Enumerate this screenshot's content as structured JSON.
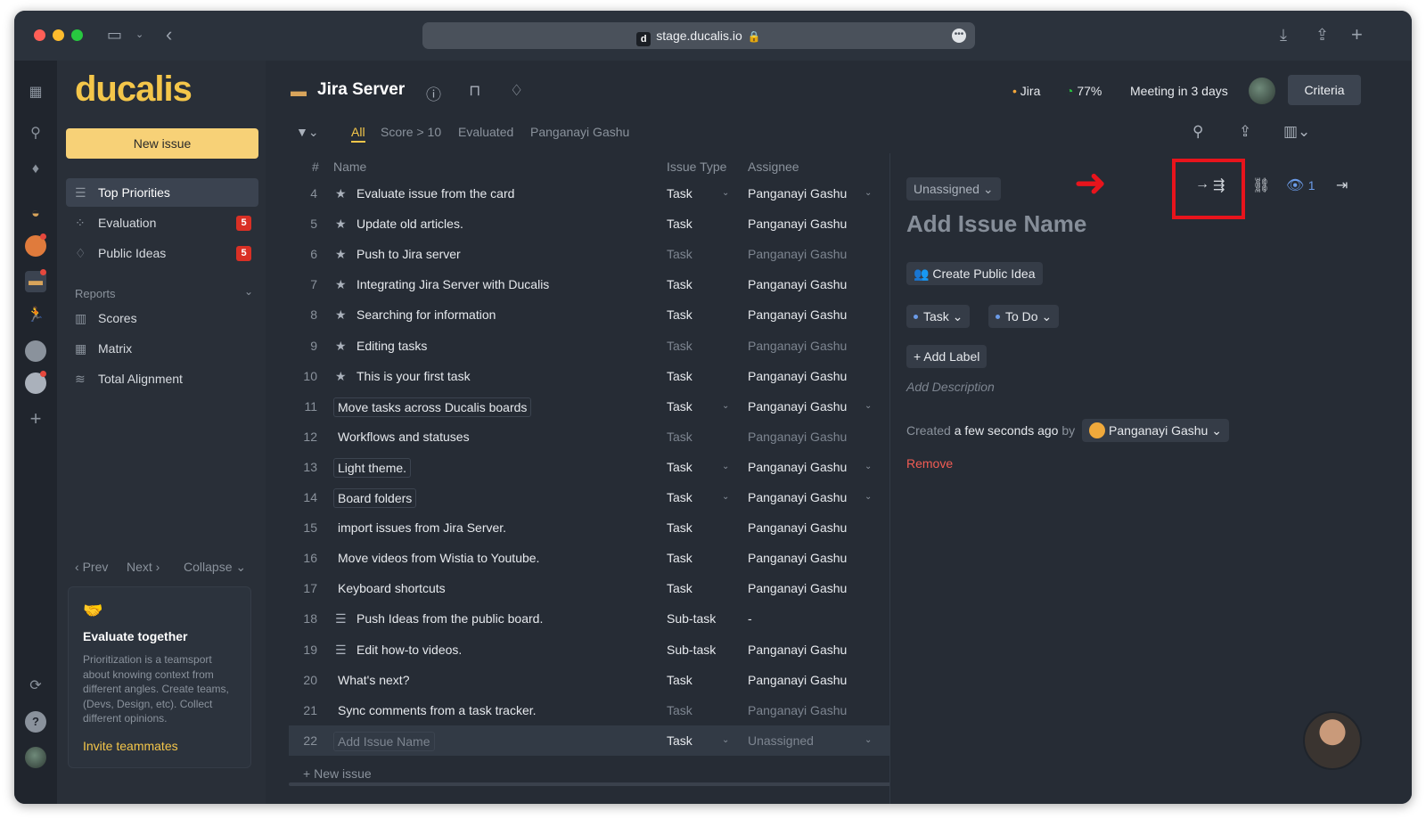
{
  "browser": {
    "url": "stage.ducalis.io",
    "favicon_letter": "d"
  },
  "sidebar": {
    "logo": "ducalis",
    "new_issue": "New issue",
    "nav": [
      {
        "label": "Top Priorities",
        "icon": "list-icon",
        "active": true
      },
      {
        "label": "Evaluation",
        "icon": "nodes-icon",
        "badge": "5"
      },
      {
        "label": "Public Ideas",
        "icon": "lightbulb-icon",
        "badge": "5"
      }
    ],
    "reports_label": "Reports",
    "reports": [
      {
        "label": "Scores",
        "icon": "columns-icon"
      },
      {
        "label": "Matrix",
        "icon": "grid-icon"
      },
      {
        "label": "Total Alignment",
        "icon": "layers-icon"
      }
    ],
    "pager": {
      "prev": "Prev",
      "next": "Next",
      "collapse": "Collapse"
    },
    "promo": {
      "title": "Evaluate together",
      "text": "Prioritization is a teamsport about knowing context from different angles. Create teams, (Devs, Design, etc). Collect different opinions.",
      "link": "Invite teammates"
    }
  },
  "header": {
    "title": "Jira Server",
    "source": "Jira",
    "progress": "77%",
    "progress_value": 0.77,
    "meeting": "Meeting in 3 days",
    "criteria": "Criteria"
  },
  "filters": {
    "tabs": [
      "All",
      "Score > 10",
      "Evaluated",
      "Panganayi Gashu"
    ],
    "active": "All"
  },
  "table": {
    "columns": {
      "num": "#",
      "name": "Name",
      "type": "Issue Type",
      "assignee": "Assignee"
    },
    "rows": [
      {
        "num": "4",
        "name": "Evaluate issue from the card",
        "type": "Task",
        "assignee": "Panganayi Gashu",
        "icon": "star"
      },
      {
        "num": "5",
        "name": "Update old articles.",
        "type": "Task",
        "assignee": "Panganayi Gashu",
        "icon": "star"
      },
      {
        "num": "6",
        "name": "Push to Jira server",
        "type": "Task",
        "assignee": "Panganayi Gashu",
        "icon": "star",
        "dim": true
      },
      {
        "num": "7",
        "name": "Integrating Jira Server with Ducalis",
        "type": "Task",
        "assignee": "Panganayi Gashu",
        "icon": "star"
      },
      {
        "num": "8",
        "name": "Searching for information",
        "type": "Task",
        "assignee": "Panganayi Gashu",
        "icon": "star"
      },
      {
        "num": "9",
        "name": "Editing tasks",
        "type": "Task",
        "assignee": "Panganayi Gashu",
        "icon": "star",
        "dim": true
      },
      {
        "num": "10",
        "name": "This is your first task",
        "type": "Task",
        "assignee": "Panganayi Gashu",
        "icon": "star"
      },
      {
        "num": "11",
        "name": "Move tasks across Ducalis boards",
        "type": "Task",
        "assignee": "Panganayi Gashu",
        "editable": true
      },
      {
        "num": "12",
        "name": "Workflows and statuses",
        "type": "Task",
        "assignee": "Panganayi Gashu",
        "dim": true
      },
      {
        "num": "13",
        "name": "Light theme.",
        "type": "Task",
        "assignee": "Panganayi Gashu",
        "editable": true
      },
      {
        "num": "14",
        "name": "Board folders",
        "type": "Task",
        "assignee": "Panganayi Gashu",
        "editable": true
      },
      {
        "num": "15",
        "name": "import issues from Jira Server.",
        "type": "Task",
        "assignee": "Panganayi Gashu"
      },
      {
        "num": "16",
        "name": "Move videos from Wistia to Youtube.",
        "type": "Task",
        "assignee": "Panganayi Gashu"
      },
      {
        "num": "17",
        "name": "Keyboard shortcuts",
        "type": "Task",
        "assignee": "Panganayi Gashu"
      },
      {
        "num": "18",
        "name": "Push Ideas from the public board.",
        "type": "Sub-task",
        "assignee": "-",
        "icon": "subtask"
      },
      {
        "num": "19",
        "name": "Edit how-to videos.",
        "type": "Sub-task",
        "assignee": "Panganayi Gashu",
        "icon": "subtask"
      },
      {
        "num": "20",
        "name": "What's next?",
        "type": "Task",
        "assignee": "Panganayi Gashu"
      },
      {
        "num": "21",
        "name": "Sync comments from a task tracker.",
        "type": "Task",
        "assignee": "Panganayi Gashu",
        "dim": true
      },
      {
        "num": "22",
        "name": "Add Issue Name",
        "type": "Task",
        "assignee": "Unassigned",
        "editable": true,
        "selected": true,
        "placeholder": true
      }
    ],
    "new_issue": "New issue"
  },
  "detail": {
    "assignee": "Unassigned",
    "watchers": "1",
    "name_placeholder": "Add Issue Name",
    "create_public_idea": "Create Public Idea",
    "type": "Task",
    "status": "To Do",
    "add_label": "Add Label",
    "description_placeholder": "Add Description",
    "created_prefix": "Created",
    "created_when": "a few seconds ago",
    "created_by": "by",
    "author": "Panganayi Gashu",
    "remove": "Remove"
  }
}
